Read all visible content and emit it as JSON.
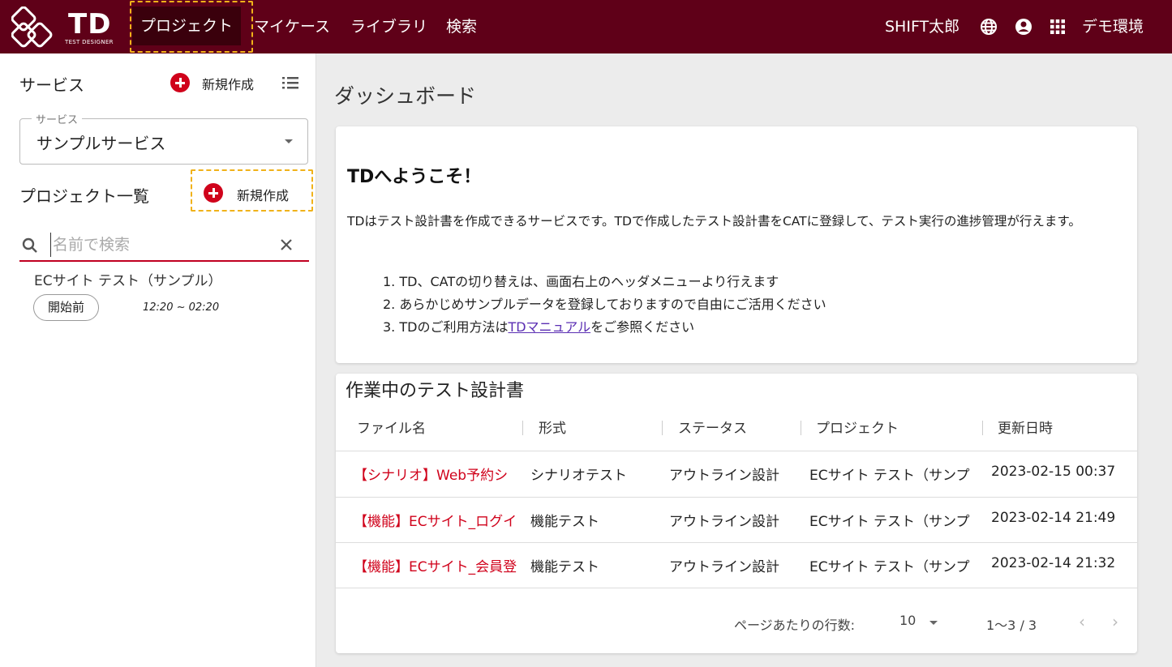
{
  "header": {
    "logo_text": "TD",
    "logo_sub": "TEST DESIGNER",
    "nav": [
      "プロジェクト",
      "マイケース",
      "ライブラリ",
      "検索"
    ],
    "user_name": "SHIFT太郎",
    "environment": "デモ環境",
    "icons": [
      "globe-icon",
      "account-circle-icon",
      "apps-grid-icon"
    ],
    "bg_color": "#5f0018",
    "active_nav_bg": "#3a000c"
  },
  "left": {
    "service_title": "サービス",
    "service_new": "新規作成",
    "service_select_label": "サービス",
    "service_select_value": "サンプルサービス",
    "project_list_title": "プロジェクト一覧",
    "project_new": "新規作成",
    "search_placeholder": "名前で検索",
    "projects": [
      {
        "name": "ECサイト テスト（サンプル）",
        "status": "開始前",
        "time": "12:20 ~ 02:20"
      }
    ]
  },
  "main": {
    "page_title": "ダッシュボード",
    "welcome": {
      "title": "TDへようこそ！",
      "description": "TDはテスト設計書を作成できるサービスです。TDで作成したテスト設計書をCATに登録して、テスト実行の進捗管理が行えます。",
      "list": [
        "1. TD、CATの切り替えは、画面右上のヘッダメニューより行えます",
        "2. あらかじめサンプルデータを登録しておりますので自由にご活用ください"
      ],
      "item3_prefix": "3. TDのご利用方法は",
      "item3_link": "TDマニュアル",
      "item3_suffix": "をご参照ください"
    },
    "table": {
      "title": "作業中のテスト設計書",
      "columns": [
        "ファイル名",
        "形式",
        "ステータス",
        "プロジェクト",
        "更新日時"
      ],
      "rows": [
        {
          "file": "【シナリオ】Web予約シ",
          "type": "シナリオテスト",
          "status": "アウトライン設計",
          "project": "ECサイト テスト（サンプ",
          "updated": "2023-02-15 00:37"
        },
        {
          "file": "【機能】ECサイト_ログイ",
          "type": "機能テスト",
          "status": "アウトライン設計",
          "project": "ECサイト テスト（サンプ",
          "updated": "2023-02-14 21:49"
        },
        {
          "file": "【機能】ECサイト_会員登",
          "type": "機能テスト",
          "status": "アウトライン設計",
          "project": "ECサイト テスト（サンプ",
          "updated": "2023-02-14 21:32"
        }
      ],
      "rows_per_page_label": "ページあたりの行数:",
      "rows_per_page_value": "10",
      "range": "1〜3 / 3"
    }
  },
  "accent_color": "#d0021b",
  "highlight_color": "#f0b21a"
}
